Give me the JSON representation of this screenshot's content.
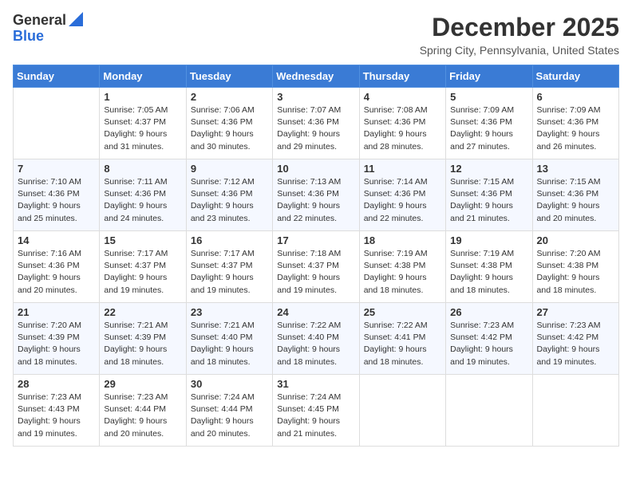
{
  "header": {
    "logo_line1": "General",
    "logo_line2": "Blue",
    "month": "December 2025",
    "location": "Spring City, Pennsylvania, United States"
  },
  "days_of_week": [
    "Sunday",
    "Monday",
    "Tuesday",
    "Wednesday",
    "Thursday",
    "Friday",
    "Saturday"
  ],
  "weeks": [
    [
      {
        "day": "",
        "empty": true
      },
      {
        "day": "1",
        "sunrise": "7:05 AM",
        "sunset": "4:37 PM",
        "daylight": "9 hours and 31 minutes."
      },
      {
        "day": "2",
        "sunrise": "7:06 AM",
        "sunset": "4:36 PM",
        "daylight": "9 hours and 30 minutes."
      },
      {
        "day": "3",
        "sunrise": "7:07 AM",
        "sunset": "4:36 PM",
        "daylight": "9 hours and 29 minutes."
      },
      {
        "day": "4",
        "sunrise": "7:08 AM",
        "sunset": "4:36 PM",
        "daylight": "9 hours and 28 minutes."
      },
      {
        "day": "5",
        "sunrise": "7:09 AM",
        "sunset": "4:36 PM",
        "daylight": "9 hours and 27 minutes."
      },
      {
        "day": "6",
        "sunrise": "7:09 AM",
        "sunset": "4:36 PM",
        "daylight": "9 hours and 26 minutes."
      }
    ],
    [
      {
        "day": "7",
        "sunrise": "7:10 AM",
        "sunset": "4:36 PM",
        "daylight": "9 hours and 25 minutes."
      },
      {
        "day": "8",
        "sunrise": "7:11 AM",
        "sunset": "4:36 PM",
        "daylight": "9 hours and 24 minutes."
      },
      {
        "day": "9",
        "sunrise": "7:12 AM",
        "sunset": "4:36 PM",
        "daylight": "9 hours and 23 minutes."
      },
      {
        "day": "10",
        "sunrise": "7:13 AM",
        "sunset": "4:36 PM",
        "daylight": "9 hours and 22 minutes."
      },
      {
        "day": "11",
        "sunrise": "7:14 AM",
        "sunset": "4:36 PM",
        "daylight": "9 hours and 22 minutes."
      },
      {
        "day": "12",
        "sunrise": "7:15 AM",
        "sunset": "4:36 PM",
        "daylight": "9 hours and 21 minutes."
      },
      {
        "day": "13",
        "sunrise": "7:15 AM",
        "sunset": "4:36 PM",
        "daylight": "9 hours and 20 minutes."
      }
    ],
    [
      {
        "day": "14",
        "sunrise": "7:16 AM",
        "sunset": "4:36 PM",
        "daylight": "9 hours and 20 minutes."
      },
      {
        "day": "15",
        "sunrise": "7:17 AM",
        "sunset": "4:37 PM",
        "daylight": "9 hours and 19 minutes."
      },
      {
        "day": "16",
        "sunrise": "7:17 AM",
        "sunset": "4:37 PM",
        "daylight": "9 hours and 19 minutes."
      },
      {
        "day": "17",
        "sunrise": "7:18 AM",
        "sunset": "4:37 PM",
        "daylight": "9 hours and 19 minutes."
      },
      {
        "day": "18",
        "sunrise": "7:19 AM",
        "sunset": "4:38 PM",
        "daylight": "9 hours and 18 minutes."
      },
      {
        "day": "19",
        "sunrise": "7:19 AM",
        "sunset": "4:38 PM",
        "daylight": "9 hours and 18 minutes."
      },
      {
        "day": "20",
        "sunrise": "7:20 AM",
        "sunset": "4:38 PM",
        "daylight": "9 hours and 18 minutes."
      }
    ],
    [
      {
        "day": "21",
        "sunrise": "7:20 AM",
        "sunset": "4:39 PM",
        "daylight": "9 hours and 18 minutes."
      },
      {
        "day": "22",
        "sunrise": "7:21 AM",
        "sunset": "4:39 PM",
        "daylight": "9 hours and 18 minutes."
      },
      {
        "day": "23",
        "sunrise": "7:21 AM",
        "sunset": "4:40 PM",
        "daylight": "9 hours and 18 minutes."
      },
      {
        "day": "24",
        "sunrise": "7:22 AM",
        "sunset": "4:40 PM",
        "daylight": "9 hours and 18 minutes."
      },
      {
        "day": "25",
        "sunrise": "7:22 AM",
        "sunset": "4:41 PM",
        "daylight": "9 hours and 18 minutes."
      },
      {
        "day": "26",
        "sunrise": "7:23 AM",
        "sunset": "4:42 PM",
        "daylight": "9 hours and 19 minutes."
      },
      {
        "day": "27",
        "sunrise": "7:23 AM",
        "sunset": "4:42 PM",
        "daylight": "9 hours and 19 minutes."
      }
    ],
    [
      {
        "day": "28",
        "sunrise": "7:23 AM",
        "sunset": "4:43 PM",
        "daylight": "9 hours and 19 minutes."
      },
      {
        "day": "29",
        "sunrise": "7:23 AM",
        "sunset": "4:44 PM",
        "daylight": "9 hours and 20 minutes."
      },
      {
        "day": "30",
        "sunrise": "7:24 AM",
        "sunset": "4:44 PM",
        "daylight": "9 hours and 20 minutes."
      },
      {
        "day": "31",
        "sunrise": "7:24 AM",
        "sunset": "4:45 PM",
        "daylight": "9 hours and 21 minutes."
      },
      {
        "day": "",
        "empty": true
      },
      {
        "day": "",
        "empty": true
      },
      {
        "day": "",
        "empty": true
      }
    ]
  ],
  "labels": {
    "sunrise_prefix": "Sunrise: ",
    "sunset_prefix": "Sunset: ",
    "daylight_prefix": "Daylight: "
  }
}
